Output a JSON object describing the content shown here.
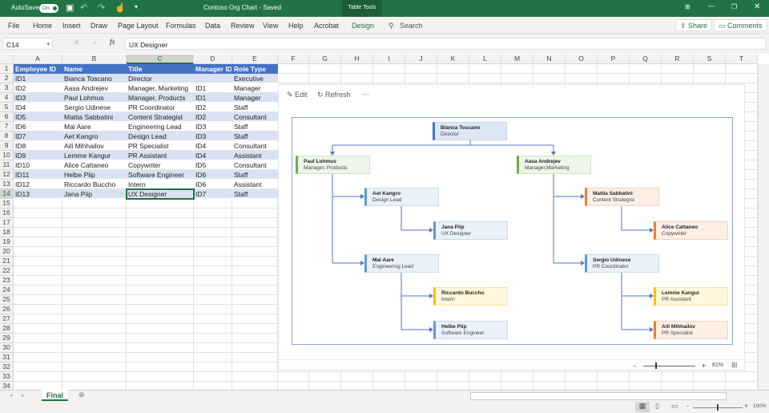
{
  "titlebar": {
    "autosave_label": "AutoSave",
    "autosave_state": "On",
    "doc_title": "Contoso Org Chart  -  Saved",
    "table_tools": "Table Tools"
  },
  "ribbon": {
    "tabs": [
      "File",
      "Home",
      "Insert",
      "Draw",
      "Page Layout",
      "Formulas",
      "Data",
      "Review",
      "View",
      "Help",
      "Acrobat",
      "Design"
    ],
    "search_placeholder": "Search",
    "share": "Share",
    "comments": "Comments"
  },
  "formula_bar": {
    "name_box": "C14",
    "fx": "fx",
    "value": "UX Designer"
  },
  "grid": {
    "columns": [
      "A",
      "B",
      "C",
      "D",
      "E",
      "F",
      "G",
      "H",
      "I",
      "J",
      "K",
      "L",
      "M",
      "N",
      "O",
      "P",
      "Q",
      "R",
      "S",
      "T"
    ],
    "row_count": 34,
    "selected_cell": "C14",
    "headers": [
      "Employee ID",
      "Name",
      "Title",
      "Manager ID",
      "Role Type"
    ],
    "rows": [
      [
        "ID1",
        "Bianca Toscano",
        "Director",
        "",
        "Executive"
      ],
      [
        "ID2",
        "Aasa Andrejev",
        "Manager, Marketing",
        "ID1",
        "Manager"
      ],
      [
        "ID3",
        "Paul Lohmus",
        "Manager, Products",
        "ID1",
        "Manager"
      ],
      [
        "ID4",
        "Sergio Udinese",
        "PR Coordinator",
        "ID2",
        "Staff"
      ],
      [
        "ID5",
        "Mattia Sabbatini",
        "Content Strategist",
        "ID2",
        "Consultant"
      ],
      [
        "ID6",
        "Mai Aare",
        "Engineering Lead",
        "ID3",
        "Staff"
      ],
      [
        "ID7",
        "Aet Kangro",
        "Design Lead",
        "ID3",
        "Staff"
      ],
      [
        "ID8",
        "Aili Mihhailov",
        "PR Specialist",
        "ID4",
        "Consultant"
      ],
      [
        "ID9",
        "Lemme Kangur",
        "PR Assistant",
        "ID4",
        "Assistant"
      ],
      [
        "ID10",
        "Alice Cattaneo",
        "Copywriter",
        "ID5",
        "Consultant"
      ],
      [
        "ID11",
        "Helbe Piip",
        "Software Engineer",
        "ID6",
        "Staff"
      ],
      [
        "ID12",
        "Riccardo Buccho",
        "Intern",
        "ID6",
        "Assistant"
      ],
      [
        "ID13",
        "Jana Piip",
        "UX Designer",
        "ID7",
        "Staff"
      ]
    ]
  },
  "panel": {
    "edit": "Edit",
    "refresh": "Refresh",
    "more": "···",
    "zoom": "81%"
  },
  "org_chart": {
    "role_colors": {
      "Executive": {
        "bg": "#dde6f4",
        "accent": "#4472c4",
        "border": "#c5d3ea"
      },
      "Manager": {
        "bg": "#eef5e9",
        "accent": "#70ad47",
        "border": "#cfe3c1"
      },
      "Staff": {
        "bg": "#eaf1f9",
        "accent": "#5b9bd5",
        "border": "#c9dcf0"
      },
      "Consultant": {
        "bg": "#fcefe6",
        "accent": "#ed7d31",
        "border": "#f6d3bb"
      },
      "Assistant": {
        "bg": "#fff6dc",
        "accent": "#ffc000",
        "border": "#fbe3a0"
      }
    },
    "nodes": [
      {
        "id": "ID1",
        "name": "Bianca Toscano",
        "title": "Director",
        "role": "Executive"
      },
      {
        "id": "ID3",
        "name": "Paul Lohmus",
        "title": "Manager, Products",
        "role": "Manager"
      },
      {
        "id": "ID2",
        "name": "Aasa Andrejev",
        "title": "Manager,Marketing",
        "role": "Manager"
      },
      {
        "id": "ID7",
        "name": "Aet Kangro",
        "title": "Design Lead",
        "role": "Staff"
      },
      {
        "id": "ID13",
        "name": "Jana Piip",
        "title": "UX Designer",
        "role": "Staff"
      },
      {
        "id": "ID6",
        "name": "Mai Aare",
        "title": "Engineering Lead",
        "role": "Staff"
      },
      {
        "id": "ID12",
        "name": "Riccardo Buccho",
        "title": "Intern",
        "role": "Assistant"
      },
      {
        "id": "ID11",
        "name": "Helbe Piip",
        "title": "Software Engineer",
        "role": "Staff"
      },
      {
        "id": "ID5",
        "name": "Mattia Sabbatini",
        "title": "Content Strategist",
        "role": "Consultant"
      },
      {
        "id": "ID10",
        "name": "Alice Cattaneo",
        "title": "Copywriter",
        "role": "Consultant"
      },
      {
        "id": "ID4",
        "name": "Sergio Udinese",
        "title": "PR Coordinator",
        "role": "Staff"
      },
      {
        "id": "ID9",
        "name": "Lemme Kangur",
        "title": "PR Assistant",
        "role": "Assistant"
      },
      {
        "id": "ID8",
        "name": "Aili Mihhailov",
        "title": "PR Specialist",
        "role": "Consultant"
      }
    ]
  },
  "sheets": {
    "tabs": [
      "Final"
    ]
  },
  "status": {
    "zoom": "100%"
  }
}
